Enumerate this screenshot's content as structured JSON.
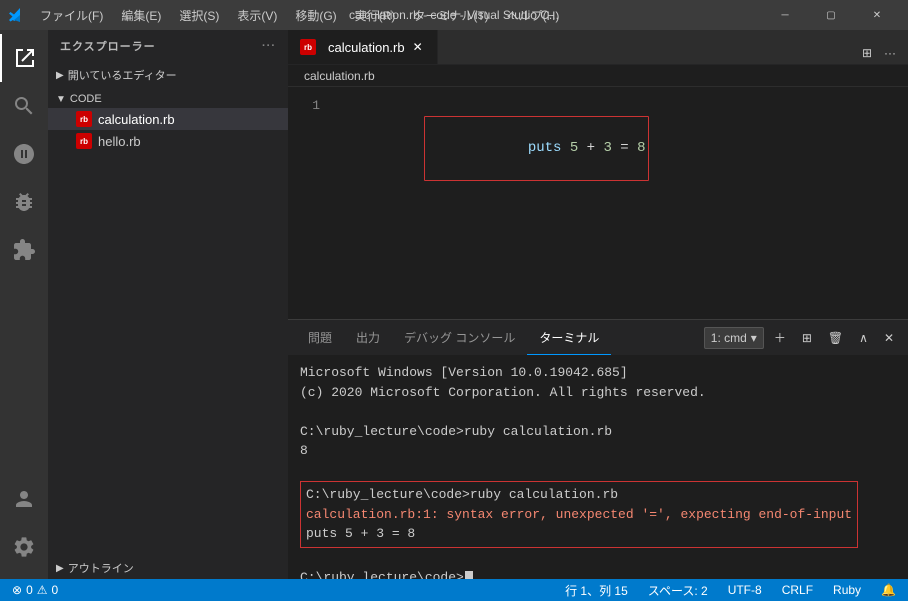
{
  "titlebar": {
    "title": "calculation.rb - code - Visual Studio C...",
    "menu_items": [
      "ファイル(F)",
      "編集(E)",
      "選択(S)",
      "表示(V)",
      "移動(G)",
      "実行(R)",
      "ターミナル(T)",
      "ヘルプ(H)"
    ]
  },
  "sidebar": {
    "header": "エクスプローラー",
    "sections": [
      {
        "name": "開いているエディター",
        "expanded": false
      },
      {
        "name": "CODE",
        "expanded": true,
        "files": [
          {
            "name": "calculation.rb",
            "active": true
          },
          {
            "name": "hello.rb",
            "active": false
          }
        ]
      },
      {
        "name": "アウトライン",
        "expanded": false
      }
    ]
  },
  "editor": {
    "tab": "calculation.rb",
    "breadcrumb": "calculation.rb",
    "lines": [
      {
        "number": "1",
        "content": "puts 5 + 3 = 8"
      }
    ]
  },
  "panel": {
    "tabs": [
      "問題",
      "出力",
      "デバッグ コンソール",
      "ターミナル"
    ],
    "active_tab": "ターミナル",
    "terminal_selector": "1: cmd",
    "terminal_lines": [
      {
        "text": "Microsoft Windows [Version 10.0.19042.685]",
        "type": "output"
      },
      {
        "text": "(c) 2020 Microsoft Corporation. All rights reserved.",
        "type": "output"
      },
      {
        "text": "",
        "type": "blank"
      },
      {
        "text": "C:\\ruby_lecture\\code>ruby calculation.rb",
        "type": "cmd"
      },
      {
        "text": "8",
        "type": "output"
      },
      {
        "text": "",
        "type": "blank"
      },
      {
        "text": "C:\\ruby_lecture\\code>ruby calculation.rb",
        "type": "error-cmd"
      },
      {
        "text": "calculation.rb:1: syntax error, unexpected '=', expecting end-of-input",
        "type": "error"
      },
      {
        "text": "puts 5 + 3 = 8",
        "type": "error"
      },
      {
        "text": "",
        "type": "blank"
      },
      {
        "text": "C:\\ruby_lecture\\code>",
        "type": "cmd-prompt"
      }
    ]
  },
  "statusbar": {
    "left": {
      "errors": "0",
      "warnings": "0"
    },
    "right": {
      "position": "行 1、列 15",
      "spaces": "スペース: 2",
      "encoding": "UTF-8",
      "eol": "CRLF",
      "language": "Ruby"
    }
  }
}
